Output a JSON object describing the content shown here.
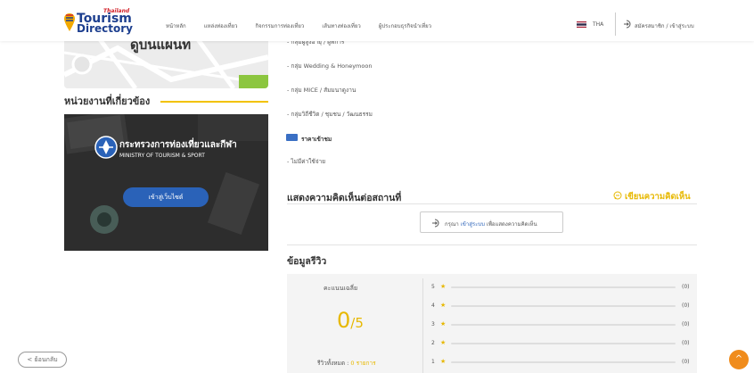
{
  "header": {
    "logo_thailand": "Thailand",
    "logo_tourism": "Tourism",
    "logo_directory": "Directory",
    "nav": [
      "หน้าหลัก",
      "แหล่งท่องเที่ยว",
      "กิจกรรมการท่องเที่ยว",
      "เส้นทางท่องเที่ยว",
      "ผู้ประกอบธุรกิจนำเที่ยว"
    ],
    "language": "THA",
    "login": "สมัครสมาชิก / เข้าสู่ระบบ"
  },
  "left": {
    "map_title": "ดูบนแผนที่",
    "related_title": "หน่วยงานที่เกี่ยวข้อง",
    "ministry_th": "กระทรวงการท่องเที่ยวและกีฬา",
    "ministry_en": "MINISTRY OF TOURISM & SPORT",
    "visit_button": "เข้าสู่เว็บไซต์"
  },
  "details": {
    "items": [
      "- กลุ่มผู้สูงอายุ / ผู้พิการ",
      "- กลุ่ม Wedding & Honeymoon",
      "- กลุ่ม MICE / สัมมนาดูงาน",
      "- กลุ่มวิถีชีวิต / ชุมชน / วัฒนธรรม"
    ],
    "price_title": "ราคาเข้าชม",
    "price_value": "- ไม่มีค่าใช้จ่าย"
  },
  "comments": {
    "title": "แสดงความคิดเห็นต่อสถานที่",
    "write": "เขียนความคิดเห็น",
    "login_prefix": "กรุณา",
    "login_link": "เข้าสู่ระบบ",
    "login_suffix": "เพื่อแสดงความคิดเห็น"
  },
  "reviews": {
    "title": "ข้อมูลรีวิว",
    "avg_label": "คะแนนเฉลี่ย",
    "score": "0",
    "score_den": "/5",
    "total_label": "รีวิวทั้งหมด :",
    "total_value": "0 รายการ",
    "rows": [
      {
        "stars": "5",
        "count": "(0)",
        "fraction": 0
      },
      {
        "stars": "4",
        "count": "(0)",
        "fraction": 0
      },
      {
        "stars": "3",
        "count": "(0)",
        "fraction": 0
      },
      {
        "stars": "2",
        "count": "(0)",
        "fraction": 0
      },
      {
        "stars": "1",
        "count": "(0)",
        "fraction": 0
      }
    ]
  },
  "footer": {
    "back": "< ย้อนกลับ",
    "top": "^"
  },
  "colors": {
    "accent": "#e7b800",
    "brand": "#1d3f8f",
    "button_blue": "#2a62b8",
    "scroll_top": "#f08c1c"
  }
}
